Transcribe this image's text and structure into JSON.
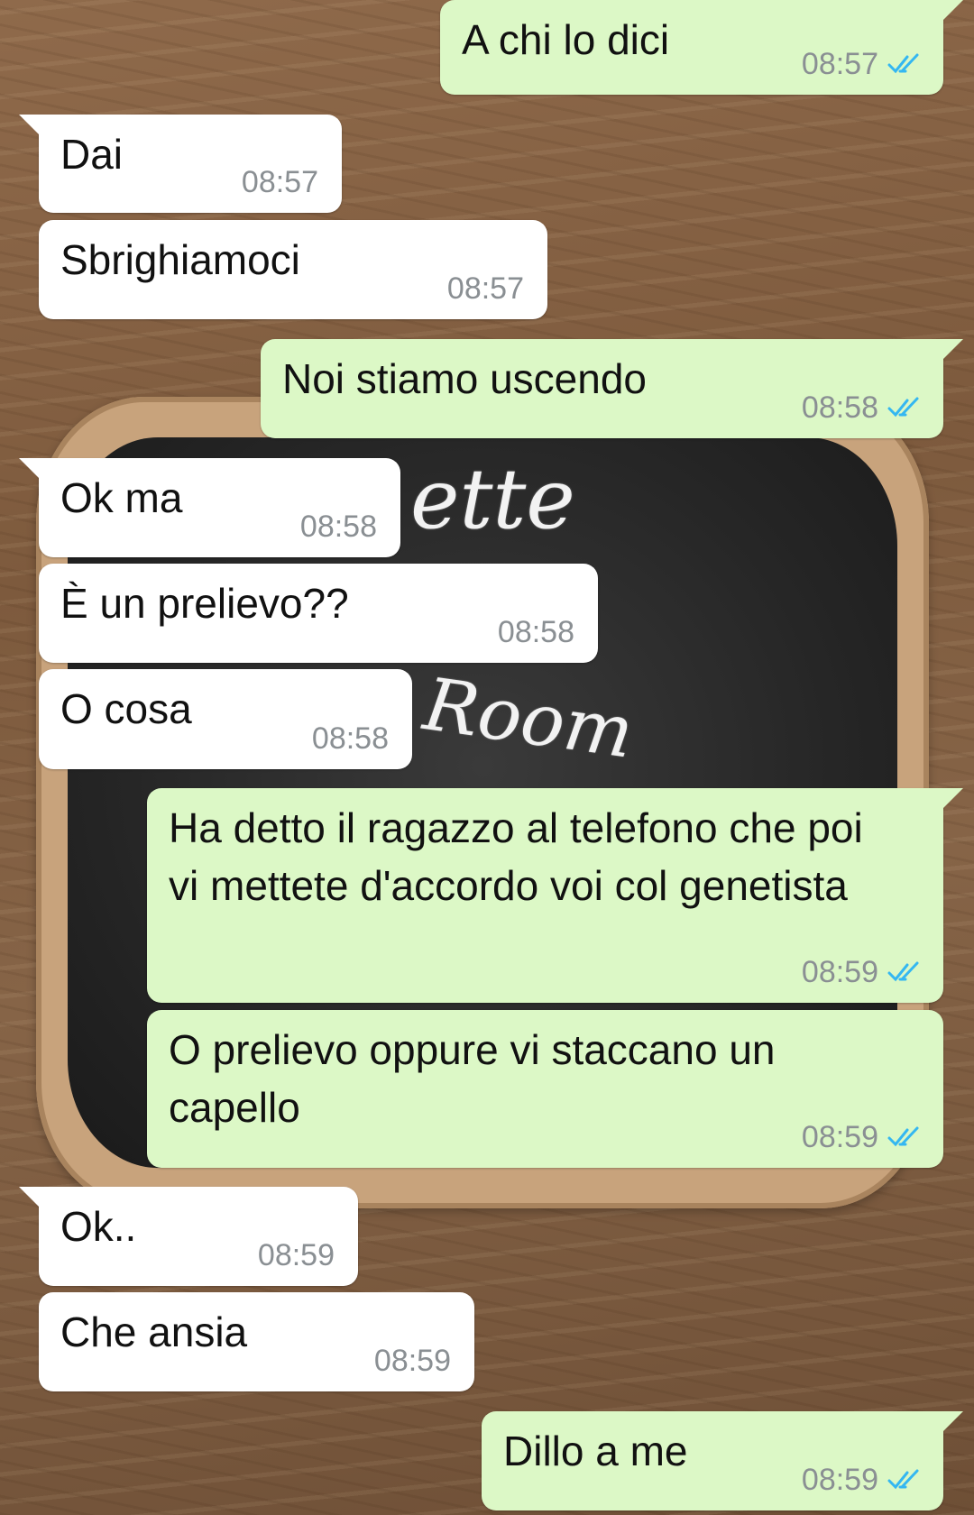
{
  "wallpaper": {
    "board_text_1": "ette",
    "board_text_2": "Room",
    "colors": {
      "wood": "#7d5a3d",
      "frame": "#c8a37c",
      "chalkboard": "#262626"
    }
  },
  "colors": {
    "incoming_bubble": "#ffffff",
    "outgoing_bubble": "#dcf8c6",
    "timestamp": "#8a8f93",
    "read_ticks": "#34b7f1"
  },
  "messages": [
    {
      "direction": "out",
      "text": "A chi lo dici",
      "time": "08:57",
      "status_icon": "double-check-read-icon"
    },
    {
      "direction": "in",
      "text": "Dai",
      "time": "08:57"
    },
    {
      "direction": "in",
      "text": "Sbrighiamoci",
      "time": "08:57"
    },
    {
      "direction": "out",
      "text": "Noi stiamo uscendo",
      "time": "08:58",
      "status_icon": "double-check-read-icon"
    },
    {
      "direction": "in",
      "text": "Ok ma",
      "time": "08:58"
    },
    {
      "direction": "in",
      "text": "È un prelievo??",
      "time": "08:58"
    },
    {
      "direction": "in",
      "text": "O cosa",
      "time": "08:58"
    },
    {
      "direction": "out",
      "text": "Ha detto il ragazzo al telefono che poi vi mettete d'accordo voi col genetista",
      "time": "08:59",
      "status_icon": "double-check-read-icon"
    },
    {
      "direction": "out",
      "text": "O prelievo oppure vi staccano un capello",
      "time": "08:59",
      "status_icon": "double-check-read-icon"
    },
    {
      "direction": "in",
      "text": "Ok..",
      "time": "08:59"
    },
    {
      "direction": "in",
      "text": "Che ansia",
      "time": "08:59"
    },
    {
      "direction": "out",
      "text": "Dillo a me",
      "time": "08:59",
      "status_icon": "double-check-read-icon"
    }
  ]
}
